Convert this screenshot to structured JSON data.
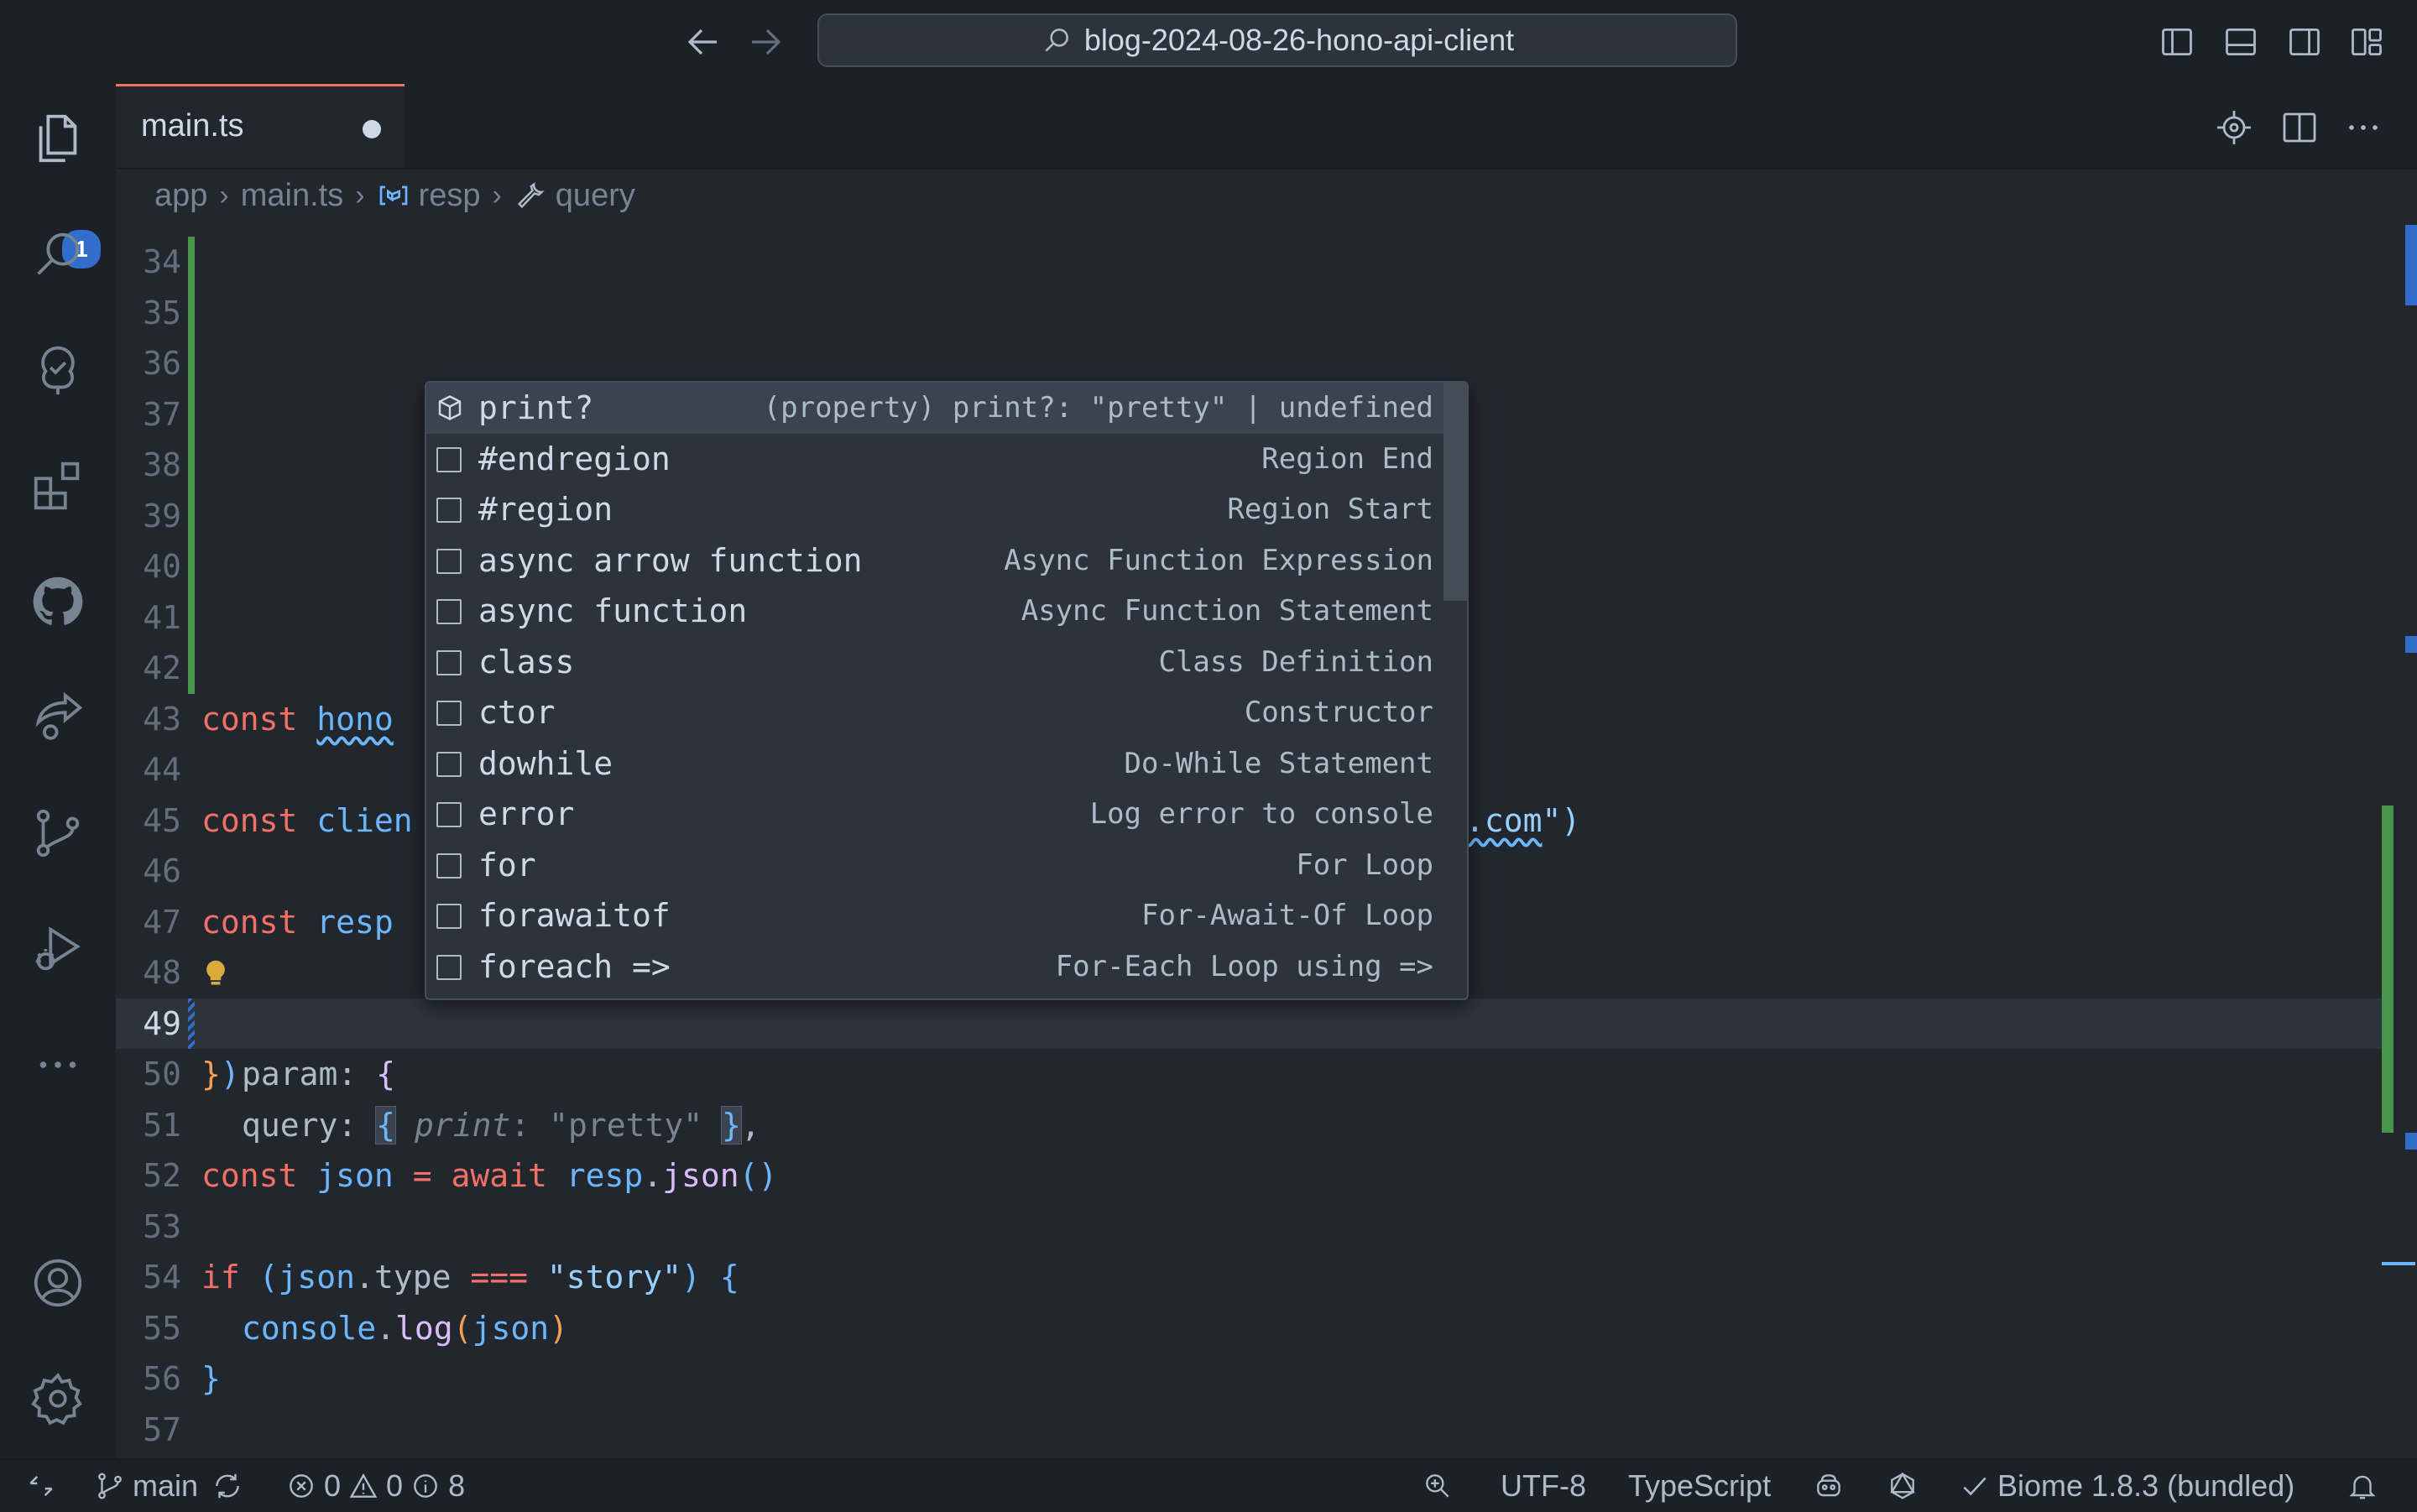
{
  "window": {
    "command_center_text": "blog-2024-08-26-hono-api-client"
  },
  "activity_bar": {
    "explorer_badge": "1"
  },
  "tabs": [
    {
      "label": "main.ts",
      "dirty": true
    }
  ],
  "breadcrumb": {
    "folder": "app",
    "file": "main.ts",
    "symbol1": "resp",
    "symbol2": "query"
  },
  "editor": {
    "current_line": "49",
    "lines": [
      {
        "n": "34"
      },
      {
        "n": "35"
      },
      {
        "n": "36"
      },
      {
        "n": "37"
      },
      {
        "n": "38"
      },
      {
        "n": "39"
      },
      {
        "n": "40"
      },
      {
        "n": "41"
      },
      {
        "n": "42"
      },
      {
        "n": "43",
        "t1": "const",
        "t2": "hono"
      },
      {
        "n": "44"
      },
      {
        "n": "45",
        "t1": "const",
        "t2": "clien",
        "t3": ".com",
        "t4": "\")"
      },
      {
        "n": "46"
      },
      {
        "n": "47",
        "t1": "const",
        "t2": "resp"
      },
      {
        "n": "48",
        "t1": "param:",
        "t2": "{"
      },
      {
        "n": "49",
        "t1": "query:",
        "t2": "{",
        "t3": "print",
        "t4": ":",
        "t5": "\"pretty\"",
        "t6": "}",
        "t7": ","
      },
      {
        "n": "50",
        "t1": "}",
        "t2": ")"
      },
      {
        "n": "51"
      },
      {
        "n": "52",
        "t1": "const",
        "t2": "json",
        "t3": "=",
        "t4": "await",
        "t5": "resp",
        "t6": ".",
        "t7": "json",
        "t8": "()"
      },
      {
        "n": "53"
      },
      {
        "n": "54",
        "t1": "if",
        "t2": "(",
        "t3": "json",
        "t4": ".type",
        "t5": "===",
        "t6": "\"story\"",
        "t7": ")",
        "t8": "{"
      },
      {
        "n": "55",
        "t1": "console",
        "t2": ".",
        "t3": "log",
        "t4": "(",
        "t5": "json",
        "t6": ")"
      },
      {
        "n": "56",
        "t1": "}"
      },
      {
        "n": "57"
      }
    ]
  },
  "suggestions": [
    {
      "label": "print?",
      "detail": "(property) print?: \"pretty\" | undefined"
    },
    {
      "label": "#endregion",
      "detail": "Region End"
    },
    {
      "label": "#region",
      "detail": "Region Start"
    },
    {
      "label": "async arrow function",
      "detail": "Async Function Expression"
    },
    {
      "label": "async function",
      "detail": "Async Function Statement"
    },
    {
      "label": "class",
      "detail": "Class Definition"
    },
    {
      "label": "ctor",
      "detail": "Constructor"
    },
    {
      "label": "dowhile",
      "detail": "Do-While Statement"
    },
    {
      "label": "error",
      "detail": "Log error to console"
    },
    {
      "label": "for",
      "detail": "For Loop"
    },
    {
      "label": "forawaitof",
      "detail": "For-Await-Of Loop"
    },
    {
      "label": "foreach =>",
      "detail": "For-Each Loop using =>"
    }
  ],
  "status_bar": {
    "branch": "main",
    "errors": "0",
    "warnings": "0",
    "infos": "8",
    "encoding": "UTF-8",
    "language": "TypeScript",
    "formatter": "Biome 1.8.3 (bundled)"
  },
  "icons": {
    "back": "arrow-left-icon",
    "forward": "arrow-right-icon",
    "search": "search-icon"
  },
  "colors": {
    "keyword": "#f47067",
    "variable": "#6cb6ff",
    "function": "#dcbdfb",
    "string": "#96d0ff",
    "added_gutter": "#46954a",
    "tab_accent": "#ec775c",
    "badge": "#316dca"
  }
}
